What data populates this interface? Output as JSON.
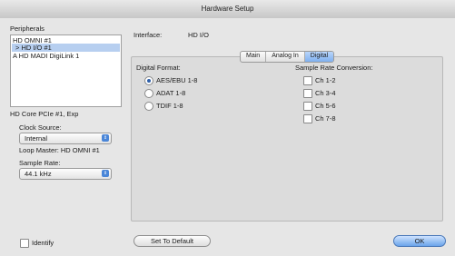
{
  "window": {
    "title": "Hardware Setup"
  },
  "peripherals": {
    "label": "Peripherals",
    "items": [
      "HD OMNI #1",
      "> HD I/O #1",
      "A HD MADI DigiLink 1"
    ],
    "selected_index": 1
  },
  "sidebar": {
    "device_info": "HD Core PCIe #1, Exp",
    "clock_source_label": "Clock Source:",
    "clock_source_value": "Internal",
    "loop_master": "Loop Master: HD OMNI #1",
    "sample_rate_label": "Sample Rate:",
    "sample_rate_value": "44.1 kHz",
    "identify_label": "Identify"
  },
  "interface": {
    "label": "Interface:",
    "value": "HD I/O"
  },
  "tabs": [
    {
      "label": "Main",
      "active": false
    },
    {
      "label": "Analog In",
      "active": false
    },
    {
      "label": "Digital",
      "active": true
    }
  ],
  "digital_format": {
    "label": "Digital Format:",
    "options": [
      {
        "label": "AES/EBU 1-8",
        "selected": true
      },
      {
        "label": "ADAT 1-8",
        "selected": false
      },
      {
        "label": "TDIF 1-8",
        "selected": false
      }
    ]
  },
  "src": {
    "label": "Sample Rate Conversion:",
    "channels": [
      {
        "label": "Ch 1-2",
        "checked": false
      },
      {
        "label": "Ch 3-4",
        "checked": false
      },
      {
        "label": "Ch 5-6",
        "checked": false
      },
      {
        "label": "Ch 7-8",
        "checked": false
      }
    ]
  },
  "buttons": {
    "set_default": "Set To Default",
    "ok": "OK"
  }
}
